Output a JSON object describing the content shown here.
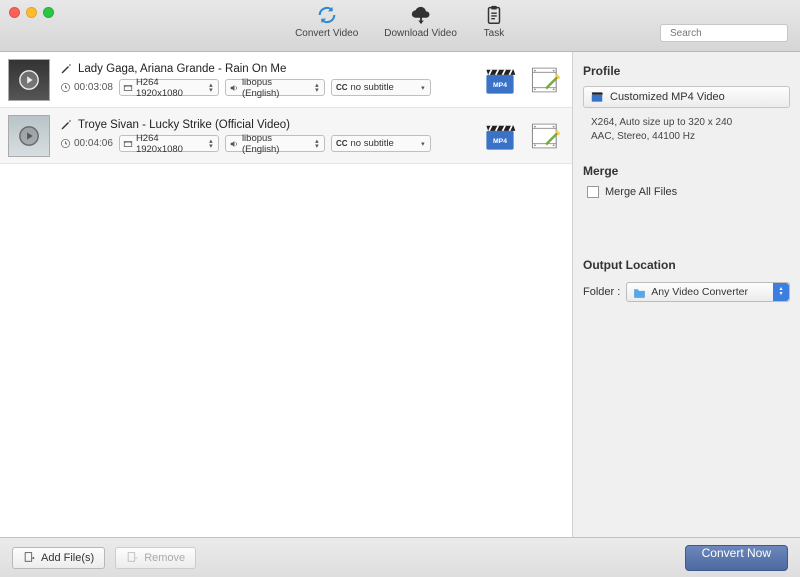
{
  "toolbar": {
    "convert": "Convert Video",
    "download": "Download Video",
    "task": "Task",
    "search_placeholder": "Search"
  },
  "videos": [
    {
      "title": "Lady Gaga, Ariana Grande - Rain On Me",
      "duration": "00:03:08",
      "format": "H264 1920x1080",
      "audio": "libopus (English)",
      "subtitle": "no subtitle",
      "sub_prefix": "CC"
    },
    {
      "title": "Troye Sivan - Lucky Strike (Official Video)",
      "duration": "00:04:06",
      "format": "H264 1920x1080",
      "audio": "libopus (English)",
      "subtitle": "no subtitle",
      "sub_prefix": "CC"
    }
  ],
  "sidebar": {
    "profile_heading": "Profile",
    "profile_name": "Customized MP4 Video",
    "profile_desc_l1": "X264, Auto size up to 320 x 240",
    "profile_desc_l2": "AAC, Stereo, 44100 Hz",
    "merge_heading": "Merge",
    "merge_label": "Merge All Files",
    "output_heading": "Output Location",
    "folder_label": "Folder :",
    "folder_value": "Any Video Converter"
  },
  "footer": {
    "add": "Add File(s)",
    "remove": "Remove",
    "convert": "Convert Now"
  }
}
